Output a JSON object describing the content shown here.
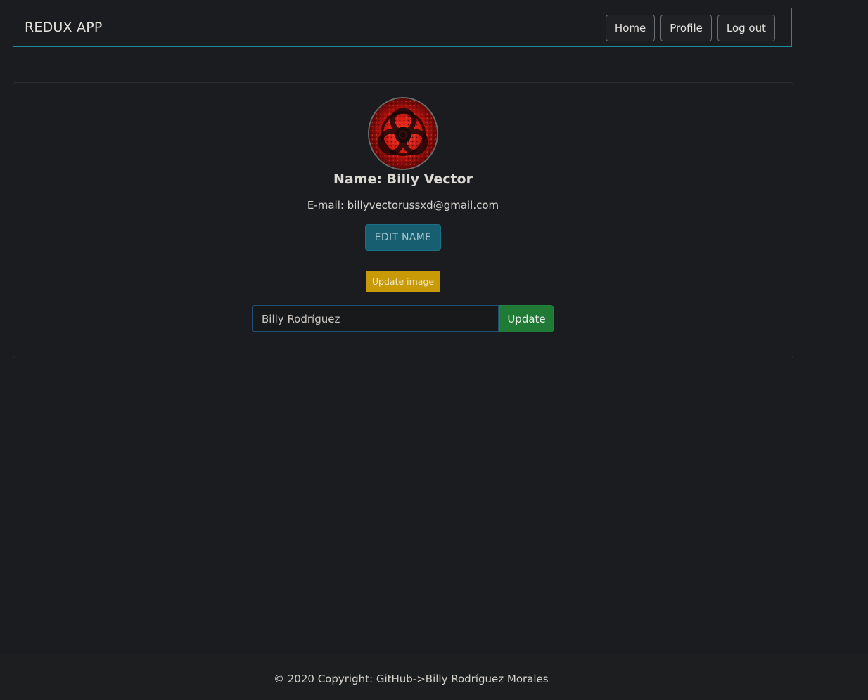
{
  "navbar": {
    "brand": "REDUX APP",
    "links": [
      "Home",
      "Profile",
      "Log out"
    ]
  },
  "profile": {
    "avatar_icon": "biohazard-avatar-image",
    "name_text": "Name: Billy Vector",
    "email_text": "E-mail: billyvectorussxd@gmail.com",
    "edit_name_label": "EDIT NAME",
    "update_image_label": "Update image",
    "name_input_value": "Billy Rodríguez",
    "submit_label": "Update"
  },
  "footer": {
    "copyright": "© 2020 Copyright: ",
    "link_text": "GitHub->Billy Rodríguez Morales"
  },
  "colors": {
    "background": "#1b1c1f",
    "navbar_border": "#1e8a99",
    "edit_button": "#175e70",
    "update_image_button": "#c99a07",
    "submit_button": "#1e7a34"
  }
}
